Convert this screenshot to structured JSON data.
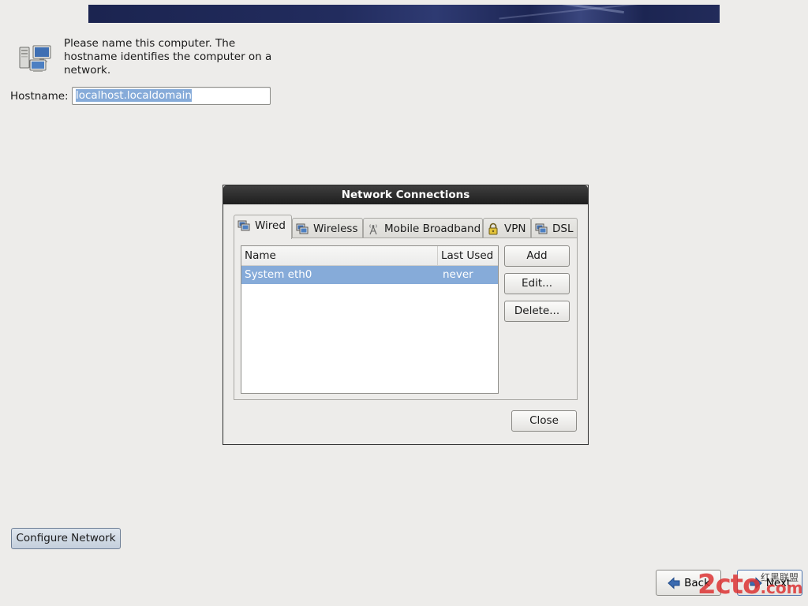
{
  "intro": {
    "text": "Please name this computer.  The hostname identifies the computer on a network."
  },
  "hostname": {
    "label": "Hostname:",
    "value": "localhost.localdomain"
  },
  "dialog": {
    "title": "Network Connections",
    "tabs": [
      {
        "label": "Wired",
        "icon": "wired-network-icon",
        "active": true
      },
      {
        "label": "Wireless",
        "icon": "wireless-network-icon",
        "active": false
      },
      {
        "label": "Mobile Broadband",
        "icon": "antenna-icon",
        "active": false
      },
      {
        "label": "VPN",
        "icon": "lock-icon",
        "active": false
      },
      {
        "label": "DSL",
        "icon": "dsl-network-icon",
        "active": false
      }
    ],
    "list": {
      "columns": [
        "Name",
        "Last Used"
      ],
      "rows": [
        {
          "name": "System eth0",
          "last_used": "never",
          "selected": true
        }
      ]
    },
    "buttons": {
      "add": "Add",
      "edit": "Edit...",
      "delete": "Delete...",
      "close": "Close"
    }
  },
  "configure_network": "Configure Network",
  "nav": {
    "back": "Back",
    "next": "Next"
  },
  "watermark": {
    "logo": "2cto",
    "logo_suffix": ".com",
    "caption": "红黑联盟"
  },
  "colors": {
    "selection": "#86abd9",
    "titlebar": "#2b2b2b",
    "background": "#edecea"
  }
}
